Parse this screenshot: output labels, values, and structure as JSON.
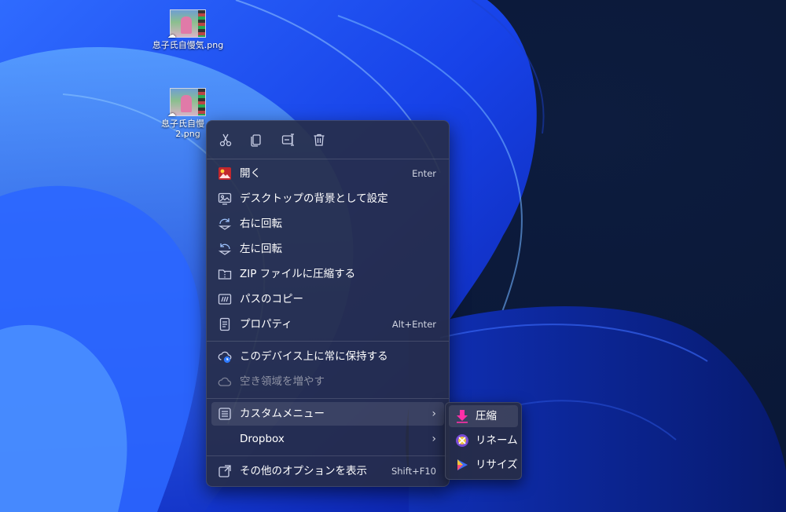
{
  "desktop": {
    "icons": [
      {
        "label": "息子氏自慢気.png"
      },
      {
        "label_line1": "息子氏自慢",
        "label_line2": "2.png"
      }
    ]
  },
  "context_menu": {
    "toolbar": [
      "cut-icon",
      "copy-icon",
      "rename-icon",
      "delete-icon"
    ],
    "items": [
      {
        "label": "開く",
        "shortcut": "Enter",
        "icon": "photos-app-icon"
      },
      {
        "label": "デスクトップの背景として設定",
        "icon": "wallpaper-icon"
      },
      {
        "label": "右に回転",
        "icon": "rotate-right-icon"
      },
      {
        "label": "左に回転",
        "icon": "rotate-left-icon"
      },
      {
        "label": "ZIP ファイルに圧縮する",
        "icon": "zip-folder-icon"
      },
      {
        "label": "パスのコピー",
        "icon": "copy-path-icon"
      },
      {
        "label": "プロパティ",
        "shortcut": "Alt+Enter",
        "icon": "properties-icon"
      },
      {
        "label": "このデバイス上に常に保持する",
        "icon": "cloud-keep-icon"
      },
      {
        "label": "空き領域を増やす",
        "icon": "cloud-icon",
        "disabled": true
      },
      {
        "label": "カスタムメニュー",
        "icon": "menu-list-icon",
        "submenu": true,
        "highlighted": true
      },
      {
        "label": "Dropbox",
        "submenu": true
      },
      {
        "label": "その他のオプションを表示",
        "shortcut": "Shift+F10",
        "icon": "more-options-icon"
      }
    ]
  },
  "submenu": {
    "items": [
      {
        "label": "圧縮",
        "icon": "download-arrow-icon",
        "highlighted": true
      },
      {
        "label": "リネーム",
        "icon": "rename-tool-icon"
      },
      {
        "label": "リサイズ",
        "icon": "resize-tool-icon"
      }
    ]
  },
  "colors": {
    "menu_bg": "#272c46",
    "accent_pink": "#ff2fa8",
    "wallpaper_blue": "#1f4fff"
  }
}
